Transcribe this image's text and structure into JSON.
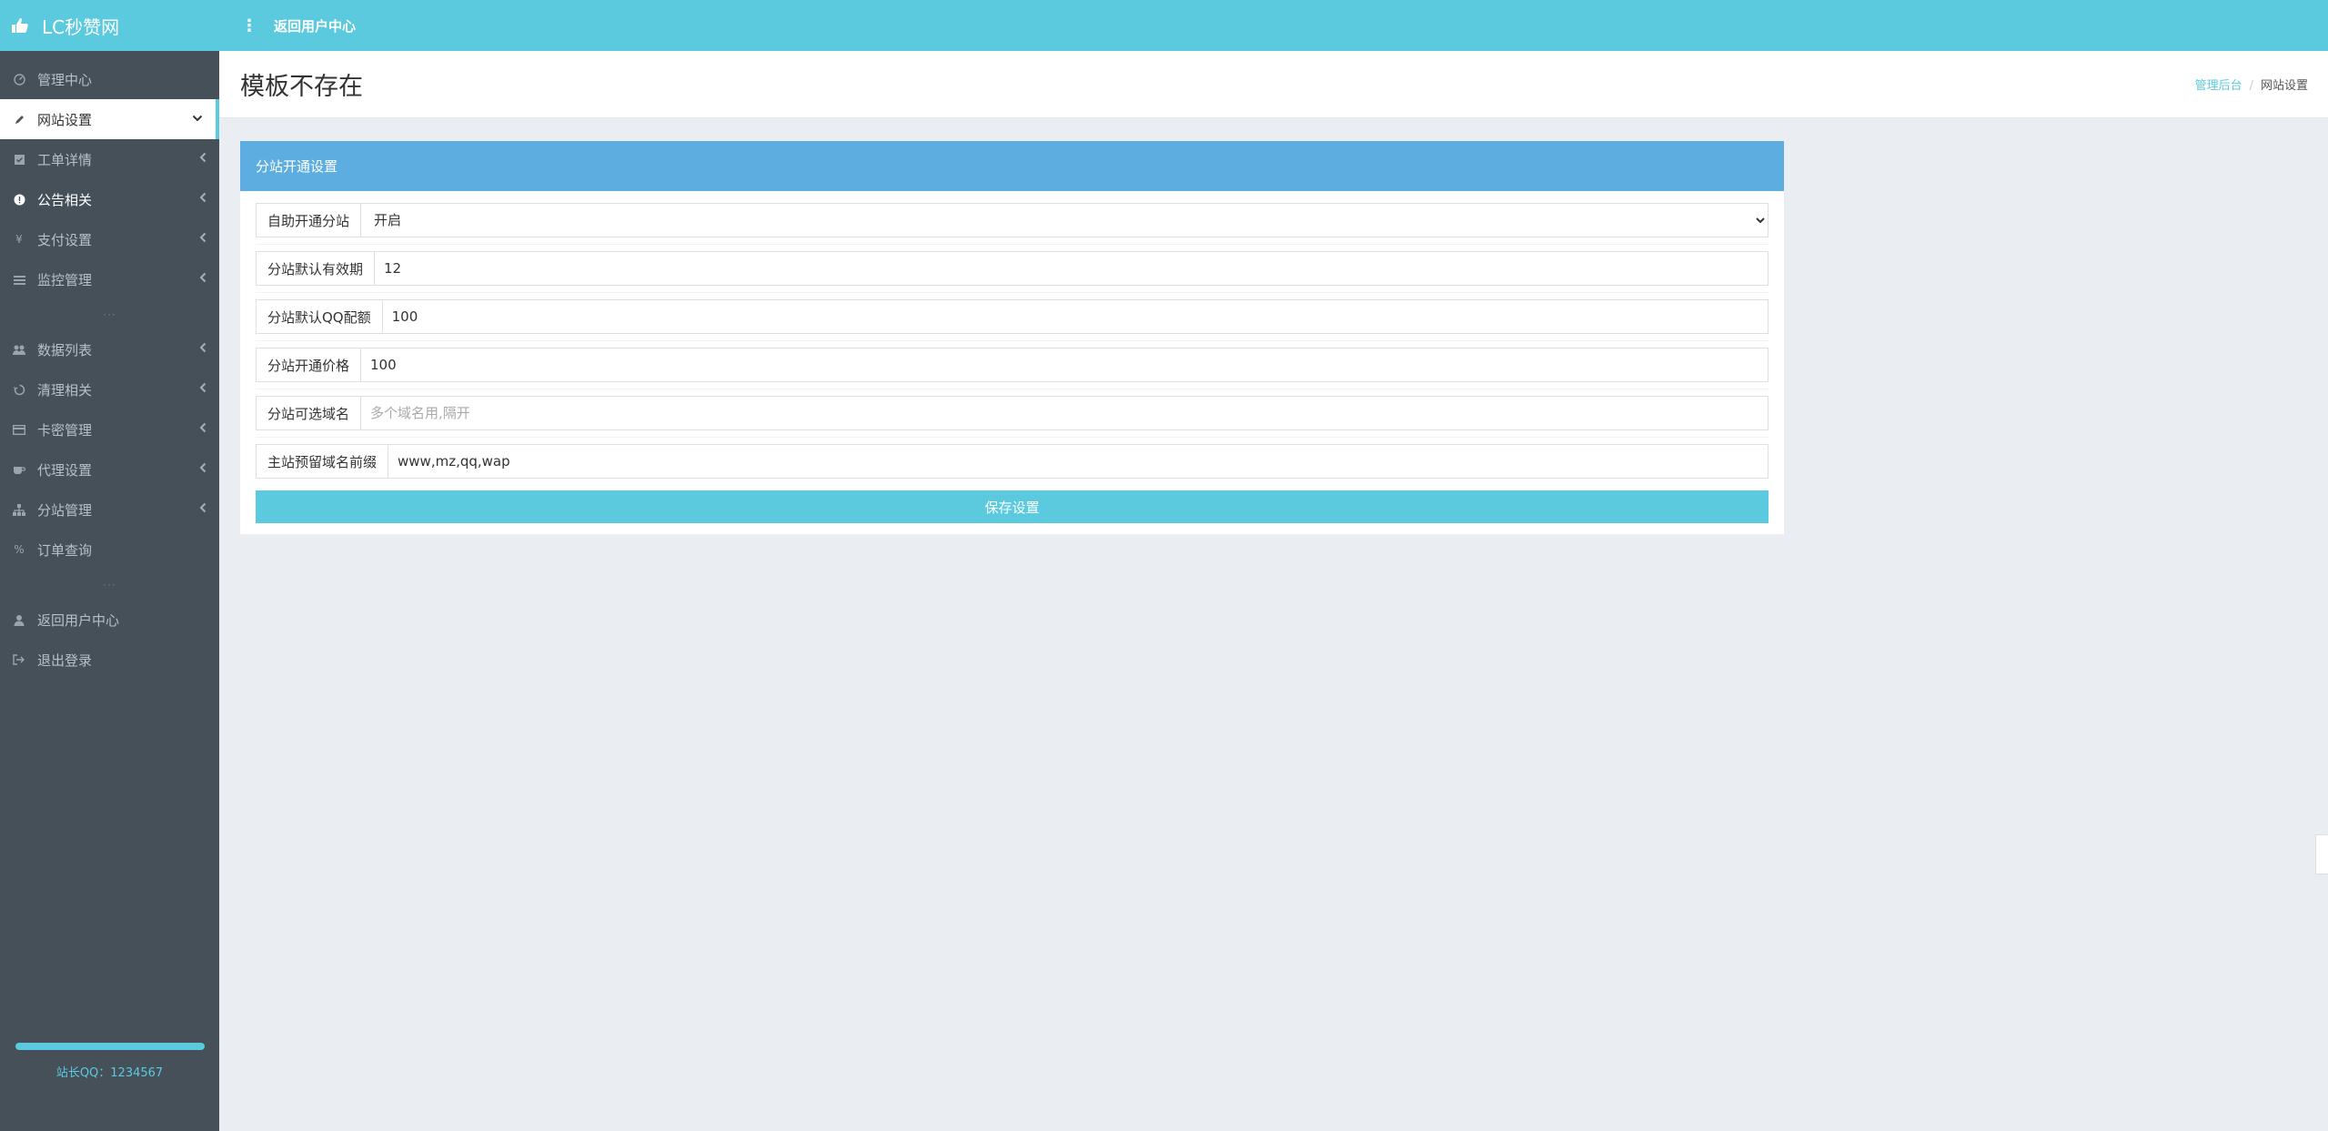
{
  "header": {
    "brand": "LC秒赞网",
    "back_link": "返回用户中心"
  },
  "sidebar": {
    "items": [
      {
        "label": "管理中心"
      },
      {
        "label": "网站设置"
      },
      {
        "label": "工单详情"
      },
      {
        "label": "公告相关"
      },
      {
        "label": "支付设置"
      },
      {
        "label": "监控管理"
      },
      {
        "label": "数据列表"
      },
      {
        "label": "清理相关"
      },
      {
        "label": "卡密管理"
      },
      {
        "label": "代理设置"
      },
      {
        "label": "分站管理"
      },
      {
        "label": "订单查询"
      },
      {
        "label": "返回用户中心"
      },
      {
        "label": "退出登录"
      }
    ],
    "icons": {
      "money": "¥",
      "percent": "%"
    },
    "owner_qq": "站长QQ：1234567"
  },
  "page": {
    "title": "模板不存在",
    "breadcrumb": {
      "home": "管理后台",
      "current": "网站设置"
    }
  },
  "panel": {
    "title": "分站开通设置",
    "fields": [
      {
        "label": "自助开通分站",
        "value": "开启",
        "options": [
          "开启"
        ]
      },
      {
        "label": "分站默认有效期",
        "value": "12"
      },
      {
        "label": "分站默认QQ配额",
        "value": "100"
      },
      {
        "label": "分站开通价格",
        "value": "100"
      },
      {
        "label": "分站可选域名",
        "value": "",
        "placeholder": "多个域名用,隔开"
      },
      {
        "label": "主站预留域名前缀",
        "value": "www,mz,qq,wap"
      }
    ],
    "save_label": "保存设置"
  },
  "colors": {
    "header": "#5bcadf",
    "sidebar": "#465059",
    "panel_head": "#5dade1",
    "link": "#5bcadf"
  }
}
